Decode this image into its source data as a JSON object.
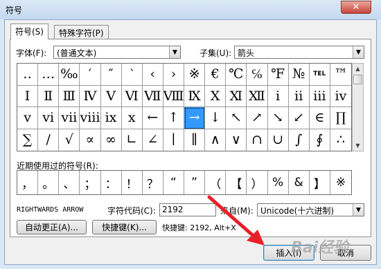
{
  "window": {
    "title": "符号",
    "close_glyph": "✕"
  },
  "tabs": [
    {
      "label": "符号(S)",
      "active": true
    },
    {
      "label": "特殊字符(P)",
      "active": false
    }
  ],
  "font": {
    "label": "字体(F):",
    "value": "(普通文本)"
  },
  "subset": {
    "label": "子集(U):",
    "value": "箭头"
  },
  "symbols": [
    "‥",
    "…",
    "‰",
    "′",
    "″",
    "‵",
    "‹",
    "›",
    "※",
    "€",
    "℃",
    "℅",
    "℉",
    "№",
    "TEL",
    "™",
    "Ⅰ",
    "Ⅱ",
    "Ⅲ",
    "Ⅳ",
    "Ⅴ",
    "Ⅵ",
    "Ⅶ",
    "Ⅷ",
    "Ⅸ",
    "Ⅹ",
    "Ⅺ",
    "Ⅻ",
    "ⅰ",
    "ⅱ",
    "ⅲ",
    "ⅳ",
    "ⅴ",
    "ⅵ",
    "ⅶ",
    "ⅷ",
    "ⅸ",
    "ⅹ",
    "←",
    "↑",
    "→",
    "↓",
    "↖",
    "↗",
    "↘",
    "↙",
    "∈",
    "∏",
    "∑",
    "∕",
    "√",
    "∝",
    "∞",
    "∟",
    "∠",
    "∣",
    "∥",
    "∧",
    "∨",
    "∩",
    "∪",
    "∫",
    "∮",
    "∴"
  ],
  "selected_index": 40,
  "recent": {
    "label": "近期使用过的符号(R):",
    "symbols": [
      "，",
      "。",
      "、",
      "；",
      "：",
      "！",
      "？",
      "“",
      "”",
      "（",
      "【",
      "）",
      "%",
      "&",
      "】",
      "※"
    ]
  },
  "char_name": "RIGHTWARDS ARROW",
  "char_code": {
    "label": "字符代码(C):",
    "value": "2192"
  },
  "source": {
    "label": "来自(M):",
    "value": "Unicode(十六进制)"
  },
  "buttons": {
    "autocorrect": "自动更正(A)...",
    "shortcut_key": "快捷键(K)...",
    "insert": "插入(I)",
    "cancel": "取消"
  },
  "shortcut_text": "快捷键: 2192, Alt+X",
  "watermark": "Bai经验"
}
